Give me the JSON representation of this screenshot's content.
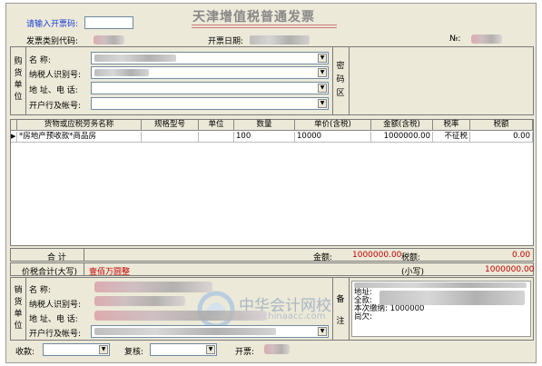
{
  "header": {
    "title": "天津增值税普通发票",
    "code_input_label": "请输入开票码:",
    "type_code_label": "发票类别代码:",
    "date_label": "开票日期:",
    "number_label": "№:"
  },
  "buyer": {
    "section_label": [
      "购",
      "货",
      "单",
      "位"
    ],
    "name_label": "名      称:",
    "tax_id_label": "纳税人识别号:",
    "address_label": "地 址、电 话:",
    "bank_label": "开户行及帐号:",
    "cipher_label": [
      "密",
      "码",
      "区"
    ]
  },
  "grid": {
    "columns": [
      "货物或应税劳务名称",
      "规格型号",
      "单位",
      "数量",
      "单价(含税)",
      "金额(含税)",
      "税率",
      "税额"
    ],
    "rows": [
      {
        "marker": "▶",
        "name": "*房地产预收款*商品房",
        "spec": "",
        "unit": "",
        "qty": "100",
        "price": "10000",
        "amount": "1000000.00",
        "rate": "不征税",
        "tax": "0.00"
      }
    ]
  },
  "totals": {
    "total_label": "合      计",
    "amount_label": "金额:",
    "amount_value": "1000000.00",
    "tax_label": "税额:",
    "tax_value": "0.00",
    "sum_upper_label": "价税合计(大写)",
    "sum_upper_value": "壹佰万圆整",
    "sum_lower_label": "(小写)",
    "sum_lower_value": "1000000.00"
  },
  "seller": {
    "section_label": [
      "销",
      "货",
      "单",
      "位"
    ],
    "name_label": "名      称:",
    "tax_id_label": "纳税人识别号:",
    "address_label": "地 址、电 话:",
    "bank_label": "开户行及帐号:",
    "remark_label": [
      "备",
      "注"
    ]
  },
  "remarks": {
    "line1": "地址:",
    "line2": "全款:",
    "line3": "本次缴纳: 1000000",
    "line4": "尚欠:"
  },
  "footer": {
    "payee_label": "收款:",
    "review_label": "复核:",
    "issuer_label": "开票:"
  },
  "watermark": {
    "cn": "中华会计网校",
    "url": "www.chinaacc.com"
  }
}
